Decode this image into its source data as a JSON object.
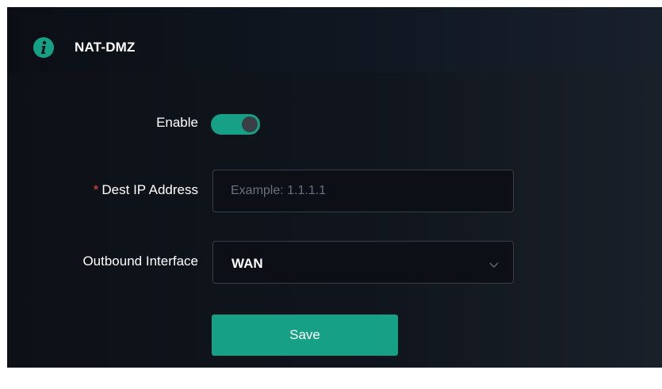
{
  "header": {
    "title": "NAT-DMZ",
    "icon": "info-icon"
  },
  "form": {
    "enable": {
      "label": "Enable",
      "on": true
    },
    "dest_ip": {
      "required_mark": "*",
      "label": "Dest IP Address",
      "placeholder": "Example: 1.1.1.1",
      "value": ""
    },
    "outbound_interface": {
      "label": "Outbound Interface",
      "selected": "WAN"
    },
    "save_label": "Save"
  },
  "colors": {
    "accent": "#16a085",
    "required": "#e74c3c",
    "background": "#0d1117"
  }
}
